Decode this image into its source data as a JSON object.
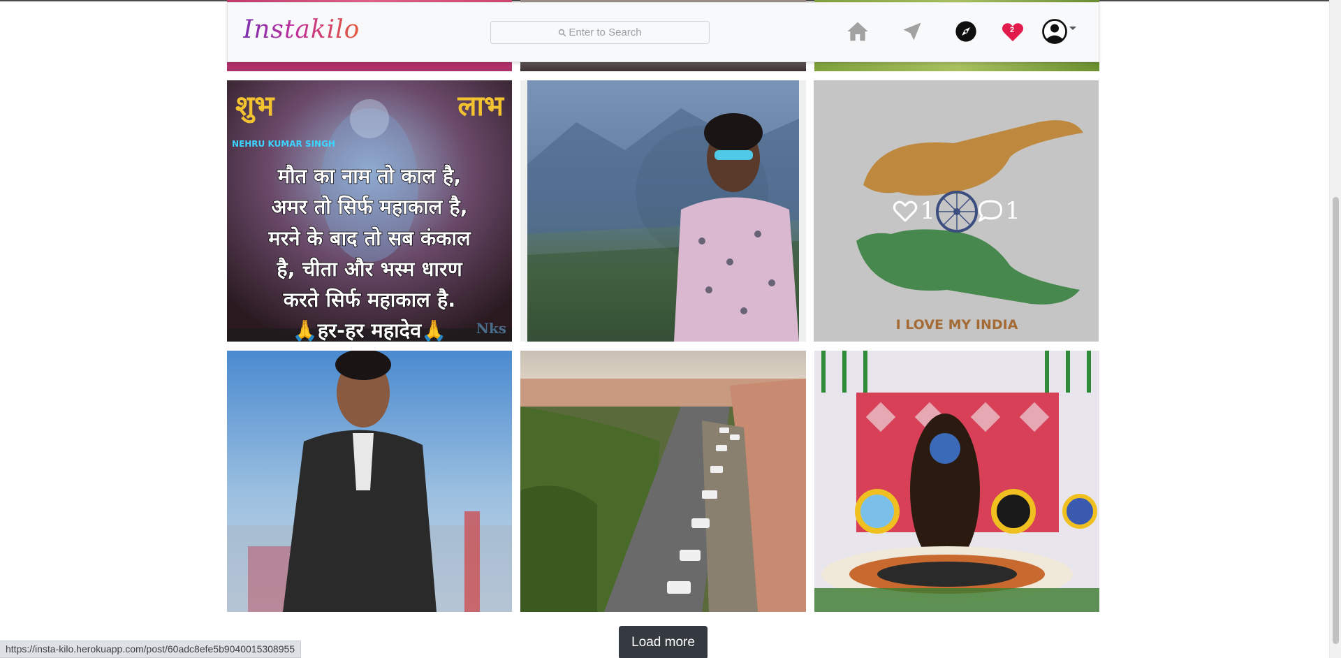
{
  "app": {
    "brand": "Instakilo"
  },
  "search": {
    "placeholder": "Enter to Search"
  },
  "nav": {
    "icons": [
      "home-icon",
      "send-icon",
      "explore-compass-icon",
      "notifications-heart-icon",
      "profile-avatar-icon"
    ],
    "notification_count": "2"
  },
  "posts": [
    {
      "name": "top-row-partial-1",
      "description": "image"
    },
    {
      "name": "top-row-partial-2",
      "description": "image"
    },
    {
      "name": "top-row-partial-3",
      "description": "image"
    },
    {
      "name": "post-shiva-quote",
      "text": {
        "top_left": "शुभ",
        "top_right": "लाभ",
        "credit": "NEHRU KUMAR SINGH",
        "line1": "मौत का नाम तो काल है,",
        "line2": "अमर तो सिर्फ महाकाल है,",
        "line3": "मरने के बाद तो सब कंकाल",
        "line4": "है, चीता और भस्म धारण",
        "line5": "करते सिर्फ महाकाल है.",
        "line6": "🙏हर-हर महादेव🙏",
        "mark": "Nks"
      }
    },
    {
      "name": "post-mountain-portrait"
    },
    {
      "name": "post-india-hands",
      "text": {
        "caption": "I LOVE MY INDIA"
      },
      "hover": {
        "likes": "1",
        "comments": "1"
      }
    },
    {
      "name": "post-leather-jacket-portrait"
    },
    {
      "name": "post-fort-road"
    },
    {
      "name": "post-shiva-shrine"
    }
  ],
  "load_more_label": "Load more",
  "status_url": "https://insta-kilo.herokuapp.com/post/60adc8efe5b9040015308955",
  "colors": {
    "navbar_bg": "#f8f9fa",
    "notification_red": "#e31b4c",
    "button_dark": "#343a40"
  }
}
